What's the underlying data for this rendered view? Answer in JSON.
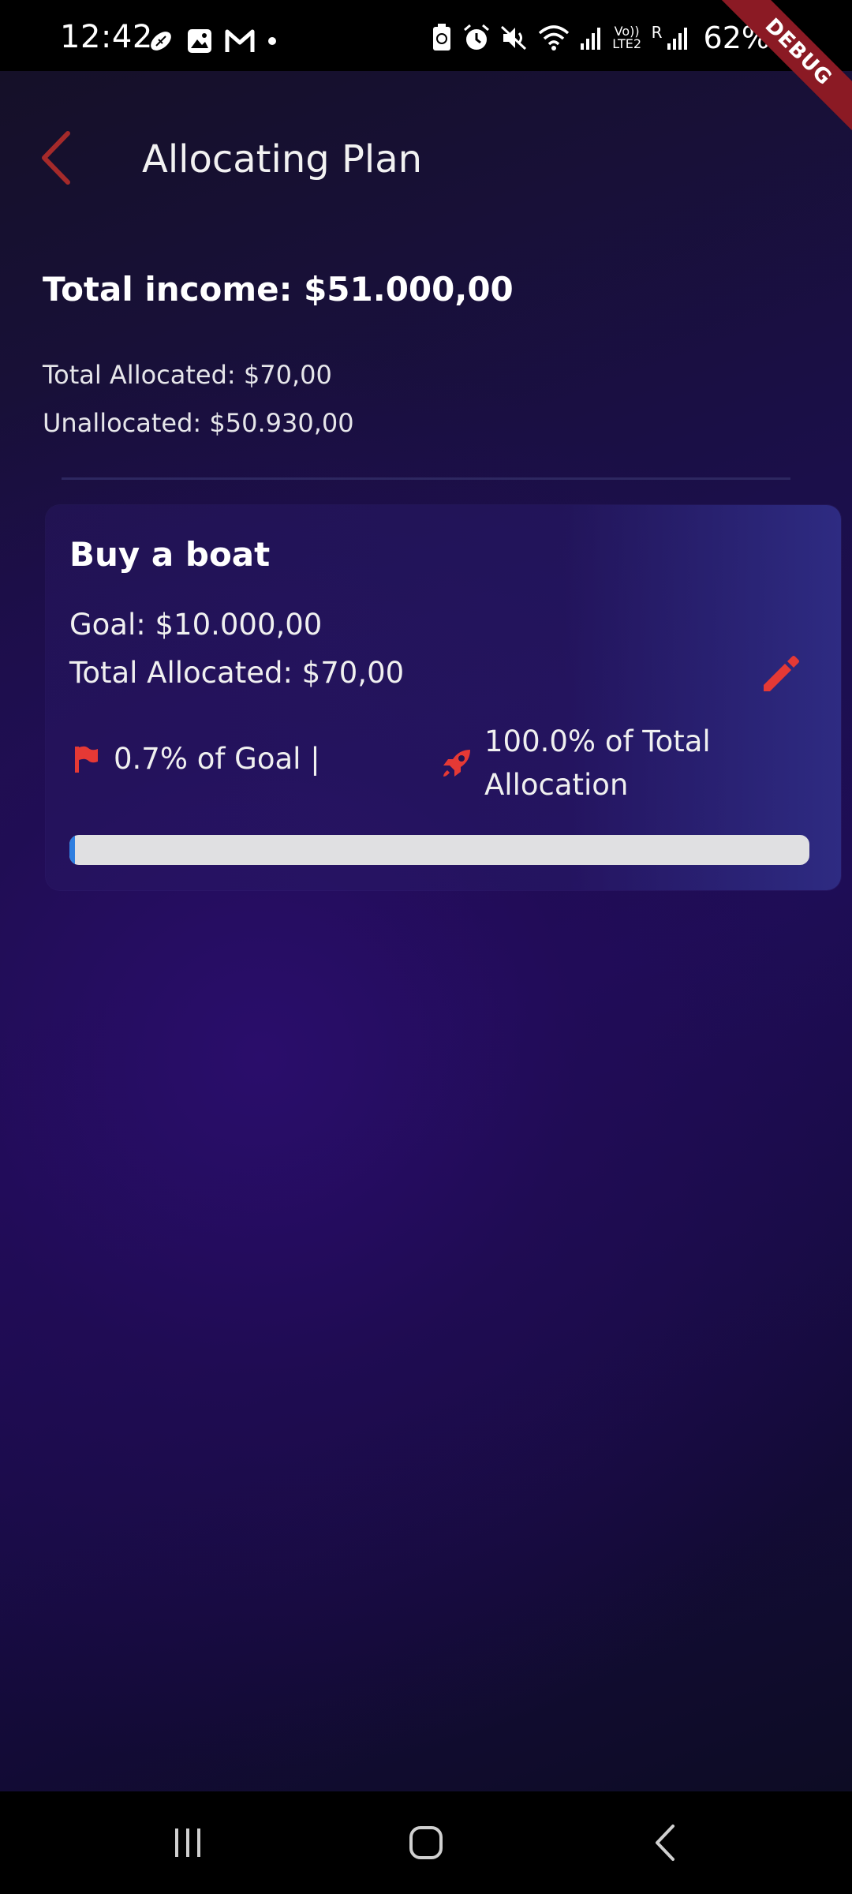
{
  "status_bar": {
    "time": "12:42",
    "battery_percent": "62%",
    "network_label_1": "Vo)) LTE2",
    "network_label_2": "R",
    "debug_label": "DEBUG"
  },
  "header": {
    "title": "Allocating Plan"
  },
  "summary": {
    "total_income": "Total income: $51.000,00",
    "total_allocated": "Total Allocated: $70,00",
    "unallocated": "Unallocated: $50.930,00"
  },
  "plans": [
    {
      "title": "Buy a boat",
      "goal": "Goal:  $10.000,00",
      "total_allocated": "Total Allocated:  $70,00",
      "goal_percent_text": "0.7% of Goal |",
      "allocation_percent_text": "100.0% of Total Allocation",
      "progress_fraction": 0.007
    }
  ],
  "colors": {
    "accent": "#e53935",
    "back_icon": "#a52a2a",
    "progress_fill": "#2f7fe0",
    "progress_track": "#e0e0e2"
  },
  "icons": {
    "back": "chevron-left-icon",
    "edit": "pencil-icon",
    "goal": "flag-icon",
    "allocation": "rocket-icon"
  }
}
